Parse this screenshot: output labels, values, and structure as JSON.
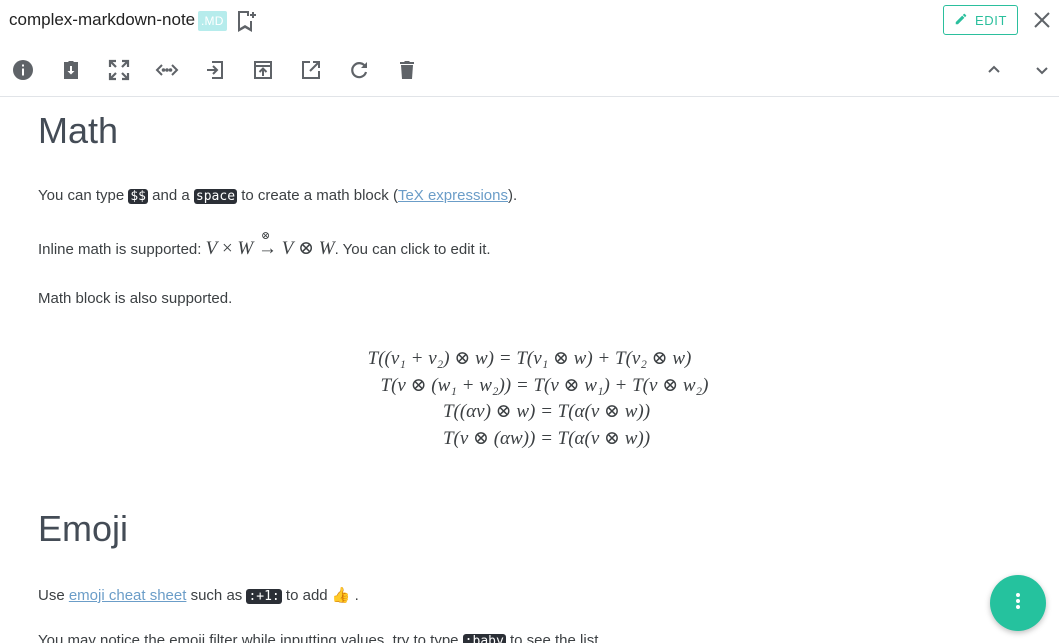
{
  "header": {
    "title": "complex-markdown-note",
    "ext_badge": ".MD",
    "edit_label": "EDIT"
  },
  "toolbar": {
    "icons": [
      "info-icon",
      "download-icon",
      "fullscreen-icon",
      "code-view-icon",
      "import-icon",
      "export-icon",
      "open-external-icon",
      "refresh-icon",
      "delete-icon",
      "chevron-up-icon",
      "chevron-down-icon"
    ]
  },
  "content": {
    "math": {
      "heading": "Math",
      "p1_before": "You can type ",
      "p1_code1": "$$",
      "p1_mid": " and a ",
      "p1_code2": "space",
      "p1_mid2": " to create a math block (",
      "p1_link": "TeX expressions",
      "p1_after": ").",
      "p2_before": "Inline math is supported: ",
      "p2_after": ". You can click to edit it.",
      "p3": "Math block is also supported.",
      "block_lines": [
        "T((v₁ + v₂) ⊗ w) = T(v₁ ⊗ w) + T(v₂ ⊗ w)",
        "T(v ⊗ (w₁ + w₂)) = T(v ⊗ w₁) + T(v ⊗ w₂)",
        "T((αv) ⊗ w) = T(α(v ⊗ w))",
        "T(v ⊗ (αw)) = T(α(v ⊗ w))"
      ]
    },
    "emoji": {
      "heading": "Emoji",
      "p1_before": "Use ",
      "p1_link": "emoji cheat sheet",
      "p1_mid": " such as ",
      "p1_code": ":+1:",
      "p1_after": " to add 👍 .",
      "p2_before": "You may notice the emoji filter while inputting values, try to type ",
      "p2_code": ":baby",
      "p2_after": " to see the list."
    }
  },
  "colors": {
    "accent": "#2bbf9d",
    "fab": "#25c29e",
    "code_bg": "#2b2f36",
    "link": "#6b9dc8"
  }
}
